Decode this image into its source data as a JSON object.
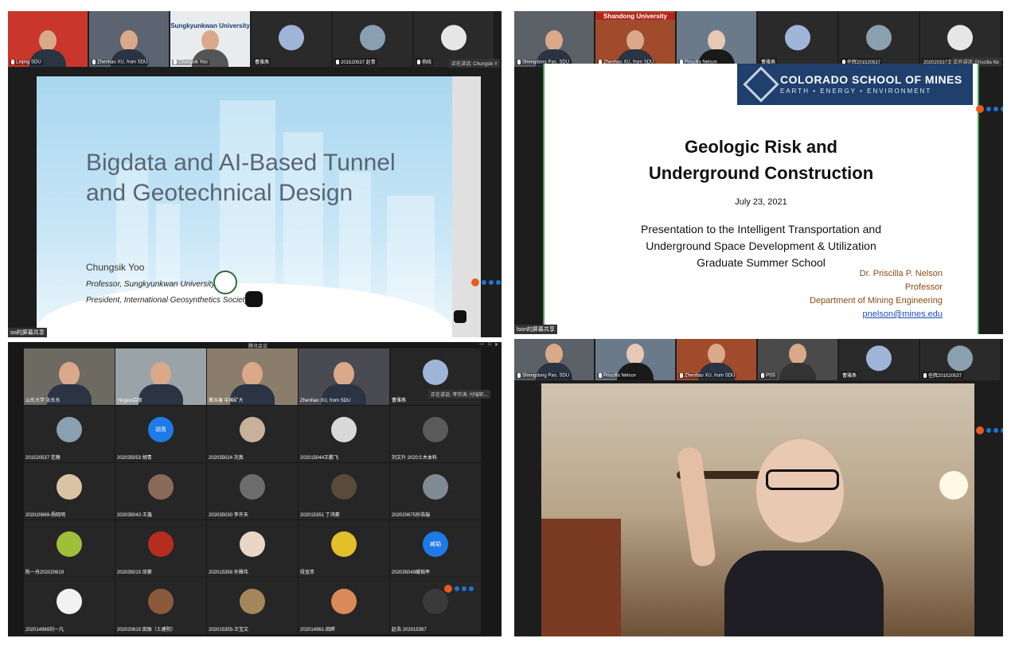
{
  "panel1": {
    "strip": [
      {
        "label": "Linjing SDU",
        "bg": "#c9372c"
      },
      {
        "label": "Zhenhao XU, from SDU",
        "bg": "#5b6470"
      },
      {
        "label": "Chungsik Yoo",
        "bg": "#e8ecef",
        "caption": "Sungkyunkwan University"
      },
      {
        "label": "曹雅燕",
        "bg": "#2a2a2a"
      },
      {
        "label": "201520537 赵青",
        "bg": "#2a2a2a"
      },
      {
        "label": "杨晓",
        "bg": "#2a2a2a"
      }
    ],
    "speaking": "正在讲话: Chungsik Y",
    "share_label": "oo的屏幕共享",
    "slide": {
      "title_line1": "Bigdata and AI-Based Tunnel",
      "title_line2": "and Geotechnical Design",
      "presenter": "Chungsik Yoo",
      "role1": "Professor, Sungkyunkwan University",
      "role2": "President, International Geosynthetics Society"
    }
  },
  "panel2": {
    "strip": [
      {
        "label": "Shengdong Pan, SDU",
        "bg": "#5c6168"
      },
      {
        "label": "Zhenhao XU, from SDU",
        "bg": "#a14b2d",
        "caption": "Shandong University"
      },
      {
        "label": "Priscilla Nelson",
        "bg": "#6a7a8a"
      },
      {
        "label": "曹雅燕",
        "bg": "#2a2a2a"
      },
      {
        "label": "任辉201520537",
        "bg": "#2a2a2a"
      },
      {
        "label": "202020337王嫣",
        "bg": "#2a2a2a"
      }
    ],
    "speaking": "正在讲话: Priscilla Ne",
    "share_label": "lson的屏幕共享",
    "slide": {
      "banner_title": "COLORADO SCHOOL OF MINES",
      "banner_sub": "EARTH • ENERGY • ENVIRONMENT",
      "title_line1": "Geologic Risk and",
      "title_line2": "Underground Construction",
      "date": "July 23, 2021",
      "pres_line1": "Presentation to the Intelligent Transportation and",
      "pres_line2": "Underground Space Development & Utilization",
      "pres_line3": "Graduate Summer School",
      "author": "Dr. Priscilla P. Nelson",
      "author_title": "Professor",
      "dept": "Department of Mining Engineering",
      "email": "pnelson@mines.edu"
    }
  },
  "panel3": {
    "window_title": "腾讯会议",
    "speaking": "正在讲话: 李宗涛; 付瑞轩...",
    "cells": [
      {
        "label": "山东大学 张东东",
        "type": "video",
        "bg": "#6d6a62"
      },
      {
        "label": "Yingxin吕敬",
        "type": "video",
        "bg": "#9aa3a8"
      },
      {
        "label": "蔡玉善 中国矿大",
        "type": "video",
        "bg": "#8a7d6c"
      },
      {
        "label": "Zhenhao XU, from SDU",
        "type": "video",
        "bg": "#4a4a52"
      },
      {
        "label": "曹雅燕",
        "type": "avatar",
        "bg": "#9fb5d8"
      },
      {
        "label": "201520537 范薇",
        "type": "avatar",
        "bg": "#8aa0b0"
      },
      {
        "label": "202035053 胡青",
        "type": "avatar",
        "bg": "#1d7ae6",
        "text": "胡青"
      },
      {
        "label": "202035024 刘真",
        "type": "avatar",
        "bg": "#c9b09a"
      },
      {
        "label": "202015044王鹏飞",
        "type": "avatar",
        "bg": "#d8d8d8"
      },
      {
        "label": "刘文升 2020土木本科",
        "type": "avatar",
        "bg": "#5a5a5a"
      },
      {
        "label": "202020669-杨晓明",
        "type": "avatar",
        "bg": "#d9c3a3"
      },
      {
        "label": "202035042-王鑫",
        "type": "avatar",
        "bg": "#8a6b5a"
      },
      {
        "label": "202035030 李许天",
        "type": "avatar",
        "bg": "#6c6c6c"
      },
      {
        "label": "202015351 丁鸿豪",
        "type": "avatar",
        "bg": "#5a4a3a"
      },
      {
        "label": "202020675孙浩瑞",
        "type": "avatar",
        "bg": "#7f8a94"
      },
      {
        "label": "陈一舟202020619",
        "type": "avatar",
        "bg": "#9fbf3a"
      },
      {
        "label": "202035015 邱豪",
        "type": "avatar",
        "bg": "#b52d1f"
      },
      {
        "label": "202015358 孙雅伟",
        "type": "avatar",
        "bg": "#e9d6c4"
      },
      {
        "label": "段宣赤",
        "type": "avatar",
        "bg": "#e3c02a"
      },
      {
        "label": "202035049臧韬亭",
        "type": "avatar",
        "bg": "#1d7ae6",
        "text": "臧韬"
      },
      {
        "label": "202014969刘一凡",
        "type": "avatar",
        "bg": "#f2f2f2"
      },
      {
        "label": "202020615 田振（土建院）",
        "type": "avatar",
        "bg": "#8a5a3a"
      },
      {
        "label": "202015355-王宝文",
        "type": "avatar",
        "bg": "#a5855a"
      },
      {
        "label": "202014961-田畔",
        "type": "avatar",
        "bg": "#d98a5a"
      },
      {
        "label": "赵浩 202015397",
        "type": "avatar",
        "bg": "#3a3a3a"
      }
    ]
  },
  "panel4": {
    "strip": [
      {
        "label": "Shengdong Pan, SDU",
        "bg": "#5c6168"
      },
      {
        "label": "Priscilla Nelson",
        "bg": "#6a7a8a"
      },
      {
        "label": "Zhenhao XU, from SDU",
        "bg": "#a14b2d"
      },
      {
        "label": "PSS",
        "bg": "#4a4a4a"
      },
      {
        "label": "曹雅燕",
        "bg": "#2a2a2a"
      },
      {
        "label": "任辉201520537",
        "bg": "#2a2a2a"
      }
    ]
  }
}
